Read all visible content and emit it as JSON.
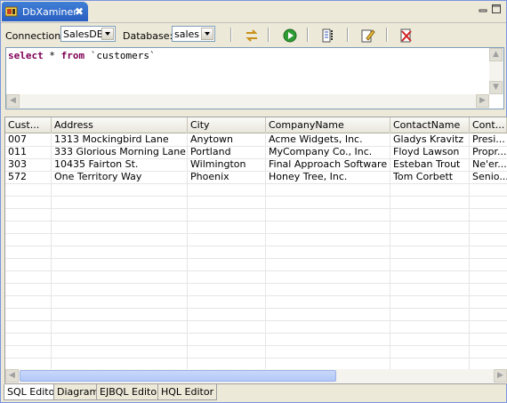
{
  "window": {
    "tab_title": "DbXaminer",
    "close_glyph": "✖"
  },
  "toolbar": {
    "connection_label": "Connection:",
    "connection_value": "SalesDB",
    "database_label": "Database:",
    "database_value": "sales",
    "buttons": [
      "swap-icon",
      "run-icon",
      "properties-icon",
      "edit-icon",
      "clear-icon"
    ]
  },
  "editor": {
    "keyword_select": "select",
    "star": "*",
    "keyword_from": "from",
    "table": "`customers`"
  },
  "grid": {
    "columns": [
      "Cust...",
      "Address",
      "City",
      "CompanyName",
      "ContactName",
      "Cont..."
    ],
    "rows": [
      [
        "007",
        "1313 Mockingbird Lane",
        "Anytown",
        "Acme Widgets, Inc.",
        "Gladys Kravitz",
        "Presi..."
      ],
      [
        "011",
        "333 Glorious Morning Lane",
        "Portland",
        "MyCompany Co., Inc.",
        "Floyd Lawson",
        "Propr..."
      ],
      [
        "303",
        "10435 Fairton St.",
        "Wilmington",
        "Final Approach Software",
        "Esteban Trout",
        "Ne'er..."
      ],
      [
        "572",
        "One Territory Way",
        "Phoenix",
        "Honey Tree, Inc.",
        "Tom Corbett",
        "Senio..."
      ]
    ]
  },
  "bottom_tabs": [
    "SQL Editor",
    "Diagram",
    "EJBQL Editor",
    "HQL Editor"
  ],
  "colors": {
    "keyword": "#7f0055",
    "tab_active": "#2a5fc1"
  }
}
